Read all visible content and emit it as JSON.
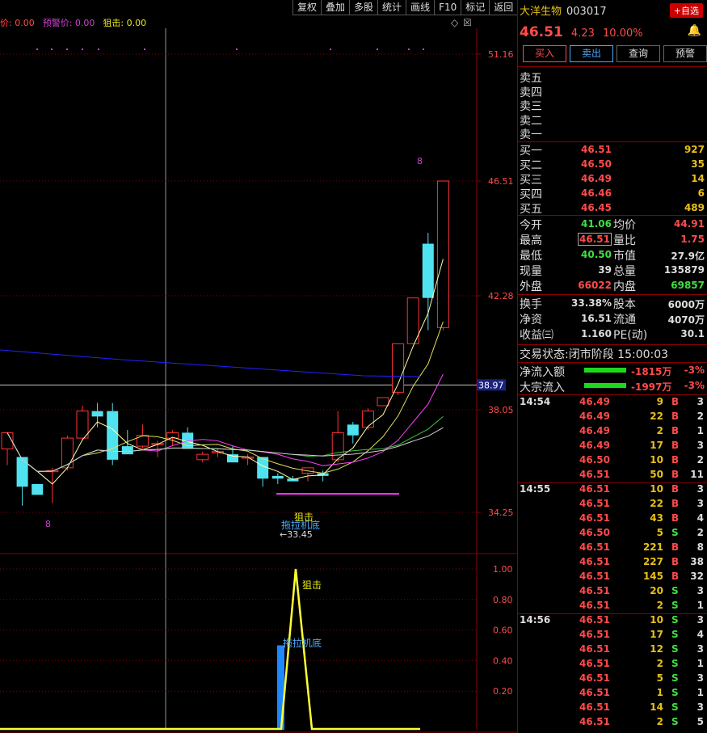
{
  "toolbar": [
    "复权",
    "叠加",
    "多股",
    "统计",
    "画线",
    "F10",
    "标记",
    "返回"
  ],
  "indicators": [
    {
      "label": "价: 0.00",
      "color": "#ff4b4b"
    },
    {
      "label": "预警价: 0.00",
      "color": "#d040d0"
    },
    {
      "label": "狙击: 0.00",
      "color": "#e8e818"
    }
  ],
  "stock": {
    "name": "大洋生物",
    "code": "003017",
    "price": "46.51",
    "change": "4.23",
    "pct": "10.00%",
    "fav": "+自选"
  },
  "actions": {
    "buy": "买入",
    "sell": "卖出",
    "query": "查询",
    "alert": "预警"
  },
  "asks": [
    "卖五",
    "卖四",
    "卖三",
    "卖二",
    "卖一"
  ],
  "bids": [
    {
      "label": "买一",
      "price": "46.51",
      "vol": "927"
    },
    {
      "label": "买二",
      "price": "46.50",
      "vol": "35"
    },
    {
      "label": "买三",
      "price": "46.49",
      "vol": "14"
    },
    {
      "label": "买四",
      "price": "46.46",
      "vol": "6"
    },
    {
      "label": "买五",
      "price": "46.45",
      "vol": "489"
    }
  ],
  "stats": [
    {
      "k1": "今开",
      "v1": "41.06",
      "c1": "green",
      "k2": "均价",
      "v2": "44.91",
      "c2": "red"
    },
    {
      "k1": "最高",
      "v1": "46.51",
      "c1": "red",
      "k2": "量比",
      "v2": "1.75",
      "c2": "red"
    },
    {
      "k1": "最低",
      "v1": "40.50",
      "c1": "green",
      "k2": "市值",
      "v2": "27.9亿",
      "c2": "white"
    },
    {
      "k1": "现量",
      "v1": "39",
      "c1": "white",
      "k2": "总量",
      "v2": "135879",
      "c2": "white"
    },
    {
      "k1": "外盘",
      "v1": "66022",
      "c1": "red",
      "k2": "内盘",
      "v2": "69857",
      "c2": "green"
    },
    {
      "k1": "换手",
      "v1": "33.38%",
      "c1": "white",
      "k2": "股本",
      "v2": "6000万",
      "c2": "white"
    },
    {
      "k1": "净资",
      "v1": "16.51",
      "c1": "white",
      "k2": "流通",
      "v2": "4070万",
      "c2": "white"
    },
    {
      "k1": "收益㈢",
      "v1": "1.160",
      "c1": "white",
      "k2": "PE(动)",
      "v2": "30.1",
      "c2": "white"
    }
  ],
  "status": {
    "label": "交易状态:",
    "value": "闭市阶段",
    "time": "15:00:03"
  },
  "flows": [
    {
      "label": "净流入额",
      "value": "-1815万",
      "pct": "-3%"
    },
    {
      "label": "大宗流入",
      "value": "-1997万",
      "pct": "-3%"
    }
  ],
  "trades": [
    {
      "time": "14:54",
      "price": "46.49",
      "vol": "9",
      "dir": "B",
      "n": "3"
    },
    {
      "time": "",
      "price": "46.49",
      "vol": "22",
      "dir": "B",
      "n": "2"
    },
    {
      "time": "",
      "price": "46.49",
      "vol": "2",
      "dir": "B",
      "n": "1"
    },
    {
      "time": "",
      "price": "46.49",
      "vol": "17",
      "dir": "B",
      "n": "3"
    },
    {
      "time": "",
      "price": "46.50",
      "vol": "10",
      "dir": "B",
      "n": "2"
    },
    {
      "time": "",
      "price": "46.51",
      "vol": "50",
      "dir": "B",
      "n": "11"
    },
    {
      "time": "14:55",
      "price": "46.51",
      "vol": "10",
      "dir": "B",
      "n": "3"
    },
    {
      "time": "",
      "price": "46.51",
      "vol": "22",
      "dir": "B",
      "n": "3"
    },
    {
      "time": "",
      "price": "46.51",
      "vol": "43",
      "dir": "B",
      "n": "4"
    },
    {
      "time": "",
      "price": "46.50",
      "vol": "5",
      "dir": "S",
      "n": "2"
    },
    {
      "time": "",
      "price": "46.51",
      "vol": "221",
      "dir": "B",
      "n": "8"
    },
    {
      "time": "",
      "price": "46.51",
      "vol": "227",
      "dir": "B",
      "n": "38"
    },
    {
      "time": "",
      "price": "46.51",
      "vol": "145",
      "dir": "B",
      "n": "32"
    },
    {
      "time": "",
      "price": "46.51",
      "vol": "20",
      "dir": "S",
      "n": "3"
    },
    {
      "time": "",
      "price": "46.51",
      "vol": "2",
      "dir": "S",
      "n": "1"
    },
    {
      "time": "14:56",
      "price": "46.51",
      "vol": "10",
      "dir": "S",
      "n": "3"
    },
    {
      "time": "",
      "price": "46.51",
      "vol": "17",
      "dir": "S",
      "n": "4"
    },
    {
      "time": "",
      "price": "46.51",
      "vol": "12",
      "dir": "S",
      "n": "3"
    },
    {
      "time": "",
      "price": "46.51",
      "vol": "2",
      "dir": "S",
      "n": "1"
    },
    {
      "time": "",
      "price": "46.51",
      "vol": "5",
      "dir": "S",
      "n": "3"
    },
    {
      "time": "",
      "price": "46.51",
      "vol": "1",
      "dir": "S",
      "n": "1"
    },
    {
      "time": "",
      "price": "46.51",
      "vol": "14",
      "dir": "S",
      "n": "3"
    },
    {
      "time": "",
      "price": "46.51",
      "vol": "2",
      "dir": "S",
      "n": "5"
    }
  ],
  "chart_data": {
    "type": "candlestick",
    "price_axis": {
      "ticks": [
        "51.16",
        "46.51",
        "42.28",
        "38.05",
        "34.25"
      ],
      "values": [
        51.16,
        46.51,
        42.28,
        38.05,
        34.25
      ],
      "current_label": "38.97",
      "current_value": 38.97
    },
    "candles": [
      [
        36.6,
        37.2,
        36.0,
        37.2
      ],
      [
        36.3,
        36.3,
        34.5,
        35.2
      ],
      [
        35.3,
        35.3,
        34.9,
        34.9
      ],
      [
        35.8,
        35.9,
        34.6,
        35.8
      ],
      [
        35.9,
        37.1,
        35.8,
        37.0
      ],
      [
        37.0,
        38.2,
        36.9,
        38.0
      ],
      [
        38.0,
        38.3,
        37.4,
        37.8
      ],
      [
        38.0,
        38.3,
        36.0,
        36.2
      ],
      [
        36.7,
        37.3,
        36.4,
        36.4
      ],
      [
        36.7,
        37.5,
        36.6,
        37.1
      ],
      [
        36.8,
        36.9,
        36.3,
        36.8
      ],
      [
        37.0,
        37.3,
        36.7,
        37.2
      ],
      [
        37.2,
        37.4,
        36.6,
        36.6
      ],
      [
        36.2,
        36.5,
        36.1,
        36.4
      ],
      [
        36.5,
        36.6,
        36.3,
        36.5
      ],
      [
        36.4,
        36.7,
        36.1,
        36.1
      ],
      [
        36.3,
        36.4,
        36.0,
        36.3
      ],
      [
        36.3,
        36.3,
        35.2,
        35.5
      ],
      [
        35.6,
        35.7,
        35.3,
        35.5
      ],
      [
        35.5,
        35.6,
        35.4,
        35.4
      ],
      [
        35.7,
        35.9,
        35.4,
        35.9
      ],
      [
        35.7,
        35.8,
        35.4,
        35.6
      ],
      [
        36.2,
        38.0,
        36.1,
        37.2
      ],
      [
        37.5,
        37.6,
        36.8,
        37.1
      ],
      [
        37.4,
        38.1,
        37.3,
        38.0
      ],
      [
        38.2,
        38.4,
        38.2,
        38.5
      ],
      [
        38.7,
        40.5,
        38.6,
        40.5
      ],
      [
        40.5,
        42.2,
        40.5,
        42.2
      ],
      [
        44.2,
        44.6,
        41.0,
        42.2
      ],
      [
        41.1,
        46.51,
        41.0,
        46.51
      ]
    ],
    "annotations": {
      "top_marker": "8",
      "bottom_marker": "8",
      "signal1": "狙击",
      "signal2": "拖拉机底",
      "low_label": "←33.45"
    },
    "sub_axis": {
      "ticks": [
        "1.00",
        "0.80",
        "0.60",
        "0.40",
        "0.20"
      ],
      "values": [
        1.0,
        0.8,
        0.6,
        0.4,
        0.2
      ]
    },
    "sub_labels": {
      "a": "狙击",
      "b": "拖拉机底"
    }
  }
}
